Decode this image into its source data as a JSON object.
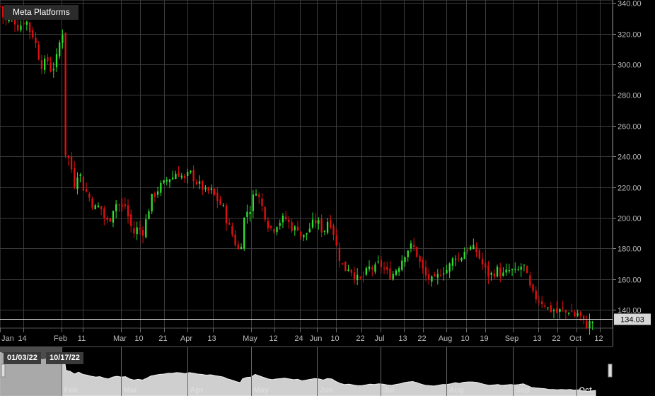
{
  "title": "Meta Platforms",
  "last_price_label": "134.03",
  "range_start": "01/03/22",
  "range_end": "10/17/22",
  "colors": {
    "up": "#2fe02f",
    "down": "#e01010",
    "grid": "#3c3c3c",
    "background": "#000000"
  },
  "chart_data": {
    "type": "candlestick",
    "ylim": [
      128,
      342
    ],
    "y_ticks": [
      "340.00",
      "320.00",
      "300.00",
      "280.00",
      "260.00",
      "240.00",
      "220.00",
      "200.00",
      "180.00",
      "160.00",
      "140.00"
    ],
    "y_tick_values": [
      340,
      320,
      300,
      280,
      260,
      240,
      220,
      200,
      180,
      160,
      140
    ],
    "last_price": 134.03,
    "x_ticks": [
      {
        "label": "Jan",
        "day": 0
      },
      {
        "label": "14",
        "day": 11
      },
      {
        "label": "Feb",
        "day": 29
      },
      {
        "label": "11",
        "day": 39
      },
      {
        "label": "Mar",
        "day": 57
      },
      {
        "label": "10",
        "day": 66
      },
      {
        "label": "21",
        "day": 77
      },
      {
        "label": "Apr",
        "day": 88
      },
      {
        "label": "13",
        "day": 100
      },
      {
        "label": "May",
        "day": 118
      },
      {
        "label": "12",
        "day": 129
      },
      {
        "label": "24",
        "day": 141
      },
      {
        "label": "Jun",
        "day": 149
      },
      {
        "label": "10",
        "day": 158
      },
      {
        "label": "22",
        "day": 170
      },
      {
        "label": "Jul",
        "day": 179
      },
      {
        "label": "13",
        "day": 190
      },
      {
        "label": "22",
        "day": 199
      },
      {
        "label": "Aug",
        "day": 210
      },
      {
        "label": "10",
        "day": 219
      },
      {
        "label": "19",
        "day": 228
      },
      {
        "label": "Sep",
        "day": 241
      },
      {
        "label": "13",
        "day": 253
      },
      {
        "label": "22",
        "day": 262
      },
      {
        "label": "Oct",
        "day": 271
      },
      {
        "label": "12",
        "day": 282
      }
    ],
    "nav_ticks": [
      {
        "label": "Feb",
        "day": 29
      },
      {
        "label": "Mar",
        "day": 57
      },
      {
        "label": "Apr",
        "day": 88
      },
      {
        "label": "May",
        "day": 118
      },
      {
        "label": "Jun",
        "day": 149
      },
      {
        "label": "Jul",
        "day": 179
      },
      {
        "label": "Aug",
        "day": 210
      },
      {
        "label": "Sep",
        "day": 241
      },
      {
        "label": "Oct",
        "day": 271
      }
    ],
    "x_range_days": [
      0,
      288
    ],
    "close_path": [
      [
        0,
        338
      ],
      [
        2,
        328
      ],
      [
        4,
        330
      ],
      [
        6,
        332
      ],
      [
        8,
        324
      ],
      [
        10,
        326
      ],
      [
        12,
        330
      ],
      [
        14,
        322
      ],
      [
        16,
        318
      ],
      [
        18,
        306
      ],
      [
        20,
        298
      ],
      [
        22,
        304
      ],
      [
        24,
        296
      ],
      [
        26,
        300
      ],
      [
        28,
        314
      ],
      [
        30,
        324
      ],
      [
        31,
        242
      ],
      [
        33,
        236
      ],
      [
        35,
        222
      ],
      [
        37,
        232
      ],
      [
        39,
        220
      ],
      [
        41,
        216
      ],
      [
        43,
        210
      ],
      [
        45,
        206
      ],
      [
        47,
        208
      ],
      [
        49,
        200
      ],
      [
        51,
        196
      ],
      [
        53,
        206
      ],
      [
        55,
        210
      ],
      [
        57,
        206
      ],
      [
        59,
        208
      ],
      [
        61,
        196
      ],
      [
        63,
        190
      ],
      [
        65,
        194
      ],
      [
        67,
        190
      ],
      [
        69,
        200
      ],
      [
        71,
        212
      ],
      [
        73,
        216
      ],
      [
        75,
        220
      ],
      [
        77,
        222
      ],
      [
        79,
        226
      ],
      [
        81,
        226
      ],
      [
        83,
        230
      ],
      [
        85,
        228
      ],
      [
        87,
        224
      ],
      [
        89,
        230
      ],
      [
        91,
        226
      ],
      [
        93,
        222
      ],
      [
        95,
        220
      ],
      [
        97,
        216
      ],
      [
        99,
        218
      ],
      [
        101,
        214
      ],
      [
        103,
        210
      ],
      [
        105,
        206
      ],
      [
        107,
        196
      ],
      [
        109,
        190
      ],
      [
        111,
        182
      ],
      [
        113,
        176
      ],
      [
        114,
        196
      ],
      [
        116,
        204
      ],
      [
        118,
        206
      ],
      [
        120,
        220
      ],
      [
        122,
        212
      ],
      [
        124,
        204
      ],
      [
        126,
        196
      ],
      [
        128,
        192
      ],
      [
        130,
        196
      ],
      [
        132,
        198
      ],
      [
        134,
        200
      ],
      [
        136,
        196
      ],
      [
        138,
        192
      ],
      [
        140,
        194
      ],
      [
        142,
        186
      ],
      [
        144,
        190
      ],
      [
        146,
        194
      ],
      [
        148,
        198
      ],
      [
        150,
        196
      ],
      [
        152,
        190
      ],
      [
        154,
        198
      ],
      [
        156,
        196
      ],
      [
        158,
        182
      ],
      [
        160,
        172
      ],
      [
        162,
        166
      ],
      [
        164,
        168
      ],
      [
        166,
        164
      ],
      [
        168,
        160
      ],
      [
        170,
        160
      ],
      [
        172,
        164
      ],
      [
        174,
        168
      ],
      [
        176,
        166
      ],
      [
        178,
        170
      ],
      [
        180,
        168
      ],
      [
        182,
        164
      ],
      [
        184,
        162
      ],
      [
        186,
        166
      ],
      [
        188,
        170
      ],
      [
        190,
        176
      ],
      [
        192,
        180
      ],
      [
        194,
        182
      ],
      [
        196,
        176
      ],
      [
        198,
        168
      ],
      [
        200,
        162
      ],
      [
        202,
        160
      ],
      [
        204,
        158
      ],
      [
        206,
        162
      ],
      [
        208,
        166
      ],
      [
        210,
        166
      ],
      [
        212,
        170
      ],
      [
        214,
        176
      ],
      [
        216,
        172
      ],
      [
        218,
        178
      ],
      [
        220,
        180
      ],
      [
        222,
        180
      ],
      [
        224,
        178
      ],
      [
        226,
        172
      ],
      [
        228,
        166
      ],
      [
        230,
        162
      ],
      [
        232,
        164
      ],
      [
        234,
        166
      ],
      [
        236,
        162
      ],
      [
        238,
        164
      ],
      [
        240,
        166
      ],
      [
        242,
        164
      ],
      [
        244,
        166
      ],
      [
        246,
        170
      ],
      [
        248,
        160
      ],
      [
        250,
        150
      ],
      [
        252,
        148
      ],
      [
        254,
        146
      ],
      [
        256,
        144
      ],
      [
        258,
        140
      ],
      [
        260,
        140
      ],
      [
        262,
        138
      ],
      [
        264,
        140
      ],
      [
        266,
        138
      ],
      [
        268,
        140
      ],
      [
        270,
        136
      ],
      [
        272,
        138
      ],
      [
        274,
        132
      ],
      [
        276,
        130
      ],
      [
        278,
        132
      ],
      [
        280,
        134
      ]
    ]
  }
}
